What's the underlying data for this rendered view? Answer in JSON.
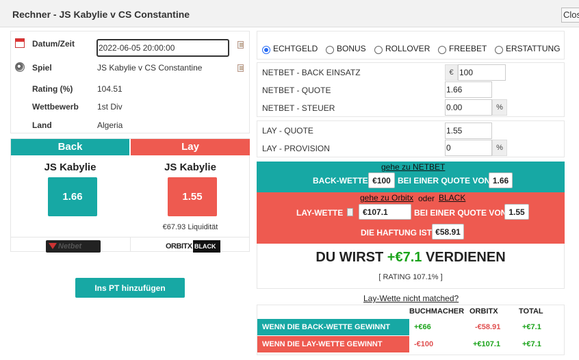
{
  "window": {
    "title": "Rechner - JS Kabylie v CS Constantine",
    "close_label": "Close"
  },
  "info": {
    "date_label": "Datum/Zeit",
    "date_value": "2022-06-05 20:00:00",
    "game_label": "Spiel",
    "game_value": "JS Kabylie v CS Constantine",
    "rating_label": "Rating (%)",
    "rating_value": "104.51",
    "competition_label": "Wettbewerb",
    "competition_value": "1st Div",
    "country_label": "Land",
    "country_value": "Algeria"
  },
  "cards": {
    "back_header": "Back",
    "lay_header": "Lay",
    "back_team": "JS Kabylie",
    "lay_team": "JS Kabylie",
    "back_odds": "1.66",
    "lay_odds": "1.55",
    "liquidity": "€67.93 Liquidität",
    "back_logo": "Netbet",
    "lay_logo_a": "ORBITX",
    "lay_logo_b": "BLACK"
  },
  "add_pt_label": "Ins PT hinzufügen",
  "bet_types": {
    "selected": "ECHTGELD",
    "options": [
      "ECHTGELD",
      "BONUS",
      "ROLLOVER",
      "FREEBET",
      "ERSTATTUNG"
    ]
  },
  "form": {
    "back_stake_label": "NETBET - BACK EINSATZ",
    "currency": "€",
    "back_stake": "100",
    "back_odds_label": "NETBET - QUOTE",
    "back_odds": "1.66",
    "tax_label": "NETBET - STEUER",
    "tax": "0.00",
    "percent": "%",
    "lay_odds_label": "LAY - QUOTE",
    "lay_odds": "1.55",
    "commission_label": "LAY - PROVISION",
    "commission": "0"
  },
  "result": {
    "back_link": "gehe zu NETBET",
    "back_bet_label": "BACK-WETTE",
    "back_amount": "€100",
    "at_odds_label": "BEI EINER QUOTE VON",
    "back_odds": "1.66",
    "lay_link_a": "gehe zu  Orbitx",
    "lay_link_or": "oder",
    "lay_link_b": "BLACK",
    "lay_bet_label": "LAY-WETTE",
    "lay_amount": "€107.1",
    "lay_odds": "1.55",
    "liability_label": "DIE HAFTUNG IST",
    "liability": "€58.91"
  },
  "earn": {
    "prefix": "DU WIRST",
    "amount": "+€7.1",
    "suffix": "VERDIENEN",
    "rating": "[ RATING 107.1% ]"
  },
  "not_matched_link": "Lay-Wette nicht matched?",
  "table": {
    "headers": [
      "BUCHMACHER",
      "ORBITX",
      "TOTAL"
    ],
    "rows": [
      {
        "label": "WENN DIE BACK-WETTE GEWINNT",
        "bookmaker": "+€66",
        "orbitx": "-€58.91",
        "total": "+€7.1"
      },
      {
        "label": "WENN DIE LAY-WETTE GEWINNT",
        "bookmaker": "-€100",
        "orbitx": "+€107.1",
        "total": "+€7.1"
      }
    ]
  },
  "colors": {
    "teal": "#17a8a4",
    "red": "#ee5a50",
    "green": "#1aa31a"
  }
}
